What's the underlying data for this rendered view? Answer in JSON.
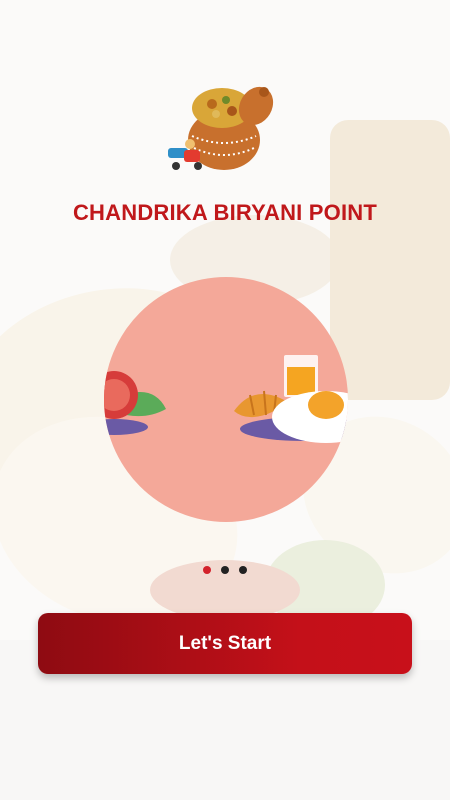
{
  "brand": {
    "title": "CHANDRIKA BIRYANI POINT"
  },
  "carousel": {
    "total_pages": 3,
    "active_page": 1
  },
  "cta": {
    "label": "Let's Start"
  },
  "colors": {
    "brand_red": "#c0181b",
    "dot_active": "#d3212b",
    "circle_bg": "#f4a899"
  },
  "icons": [
    "biryani-pot-logo-icon",
    "delivery-scooter-icon",
    "tomato-salad-icon",
    "breakfast-plate-icon",
    "orange-juice-icon",
    "croissant-icon",
    "fried-egg-icon"
  ]
}
